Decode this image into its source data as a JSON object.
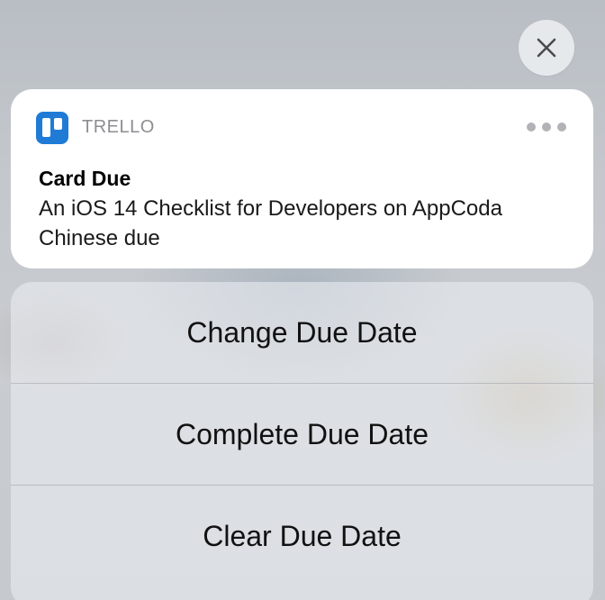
{
  "close_button": {
    "icon": "close-icon"
  },
  "notification": {
    "app_icon": "trello-icon",
    "app_name": "TRELLO",
    "more_icon": "ellipsis-icon",
    "title": "Card Due",
    "body": "An iOS 14 Checklist for Developers on AppCoda Chinese due",
    "accent_color": "#1f7bd6"
  },
  "actions": [
    {
      "label": "Change Due Date"
    },
    {
      "label": "Complete Due Date"
    },
    {
      "label": "Clear Due Date"
    }
  ]
}
